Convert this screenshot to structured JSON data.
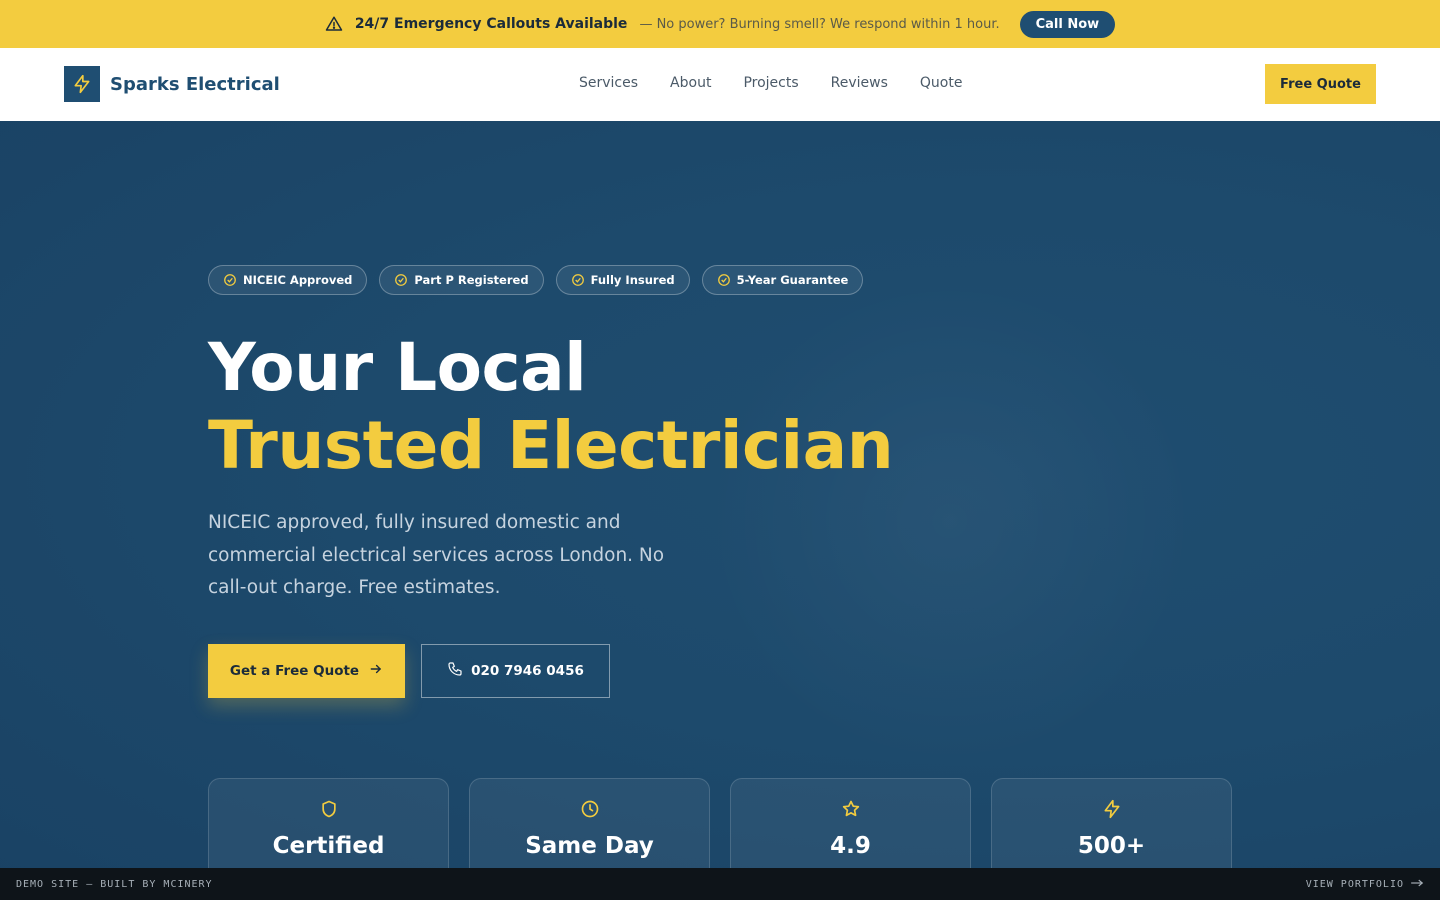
{
  "topbar": {
    "icon": "warning-triangle-icon",
    "headline": "24/7 Emergency Callouts Available",
    "message": "— No power? Burning smell? We respond within 1 hour.",
    "call_label": "Call Now"
  },
  "header": {
    "logo_icon": "lightning-bolt-icon",
    "brand": "Sparks Electrical",
    "nav": [
      "Services",
      "About",
      "Projects",
      "Reviews",
      "Quote"
    ],
    "cta_label": "Free Quote"
  },
  "hero": {
    "badges": [
      "NICEIC Approved",
      "Part P Registered",
      "Fully Insured",
      "5-Year Guarantee"
    ],
    "headline_line1": "Your Local",
    "headline_line2": "Trusted Electrician",
    "subtext": "NICEIC approved, fully insured domestic and commercial electrical services across London. No call-out charge. Free estimates.",
    "primary_cta": "Get a Free Quote",
    "phone": "020 7946 0456",
    "stats": [
      {
        "icon": "shield-icon",
        "value": "Certified"
      },
      {
        "icon": "clock-icon",
        "value": "Same Day"
      },
      {
        "icon": "star-icon",
        "value": "4.9"
      },
      {
        "icon": "lightning-bolt-icon",
        "value": "500+"
      }
    ]
  },
  "demo_strip": {
    "left": "DEMO SITE — BUILT BY MCINERY",
    "right": "VIEW PORTFOLIO"
  },
  "colors": {
    "brand_yellow": "#f3cc3f",
    "brand_blue": "#1f4e72",
    "hero_bg": "#1d4a6c"
  }
}
